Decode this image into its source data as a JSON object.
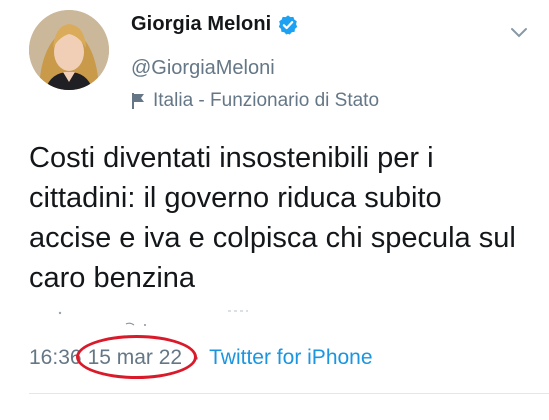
{
  "author": {
    "display_name": "Giorgia Meloni",
    "handle": "@GiorgiaMeloni",
    "label": "Italia - Funzionario di Stato"
  },
  "tweet": {
    "text": "Costi diventati insostenibili per i cittadini: il governo riduca subito accise e iva e colpisca chi specula sul caro benzina",
    "time": "16:36",
    "separator": "·",
    "date": "15 mar 22",
    "source": "Twitter for iPhone"
  },
  "icons": {
    "verified": "verified-badge-icon",
    "label": "flag-icon",
    "menu": "chevron-down-icon"
  },
  "colors": {
    "verified": "#1da1f2",
    "link": "#1b95e0",
    "circle_annotation": "#d91a2a",
    "secondary_text": "#657786"
  }
}
